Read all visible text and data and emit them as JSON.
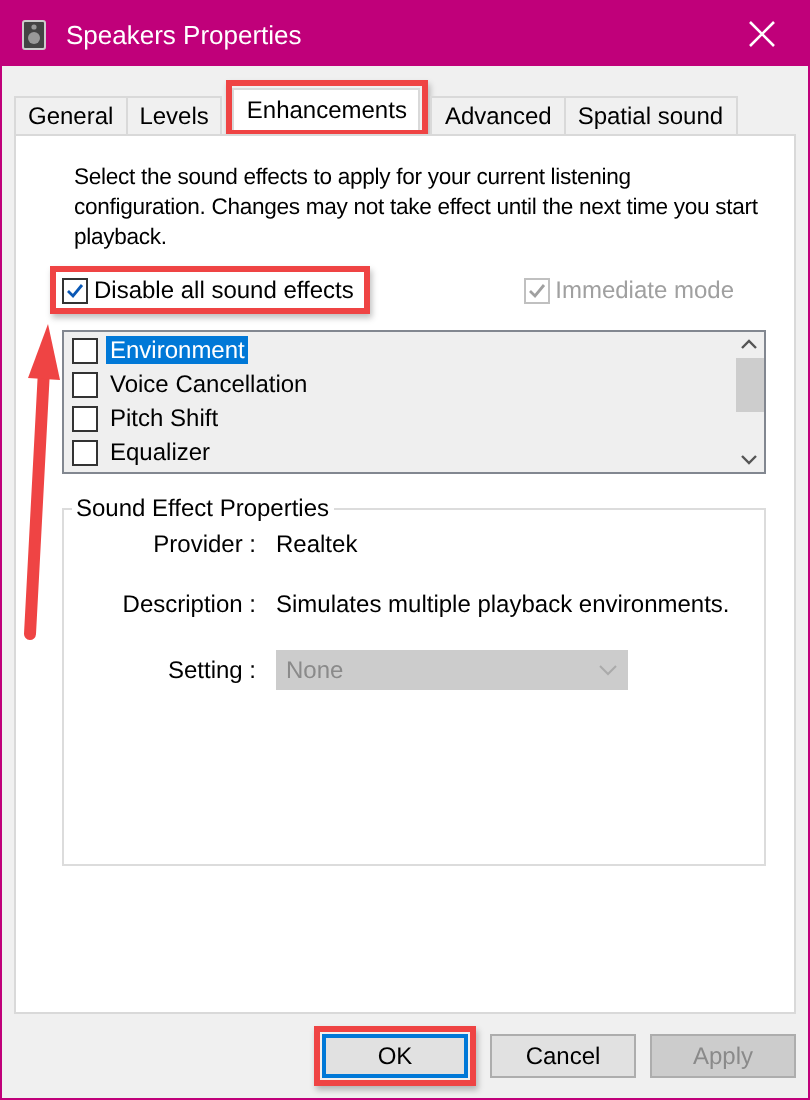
{
  "window": {
    "title": "Speakers Properties"
  },
  "tabs": [
    {
      "label": "General",
      "selected": false,
      "highlighted": false
    },
    {
      "label": "Levels",
      "selected": false,
      "highlighted": false
    },
    {
      "label": "Enhancements",
      "selected": true,
      "highlighted": true
    },
    {
      "label": "Advanced",
      "selected": false,
      "highlighted": false
    },
    {
      "label": "Spatial sound",
      "selected": false,
      "highlighted": false
    }
  ],
  "intro": "Select the sound effects to apply for your current listening configuration. Changes may not take effect until the next time you start playback.",
  "disable_all": {
    "label": "Disable all sound effects",
    "checked": true,
    "highlighted": true
  },
  "immediate_mode": {
    "label": "Immediate mode",
    "checked": true,
    "disabled": true
  },
  "effects": [
    {
      "label": "Environment",
      "checked": false,
      "selected": true
    },
    {
      "label": "Voice Cancellation",
      "checked": false,
      "selected": false
    },
    {
      "label": "Pitch Shift",
      "checked": false,
      "selected": false
    },
    {
      "label": "Equalizer",
      "checked": false,
      "selected": false
    }
  ],
  "properties": {
    "title": "Sound Effect Properties",
    "rows": [
      {
        "label": "Provider :",
        "value": "Realtek"
      },
      {
        "label": "Description :",
        "value": "Simulates multiple playback environments."
      }
    ],
    "setting": {
      "label": "Setting :",
      "value": "None",
      "disabled": true
    }
  },
  "pointer_arrow": true,
  "buttons": [
    {
      "label": "OK",
      "default": true,
      "disabled": false,
      "highlighted": true
    },
    {
      "label": "Cancel",
      "default": false,
      "disabled": false,
      "highlighted": false
    },
    {
      "label": "Apply",
      "default": false,
      "disabled": true,
      "highlighted": false
    }
  ]
}
